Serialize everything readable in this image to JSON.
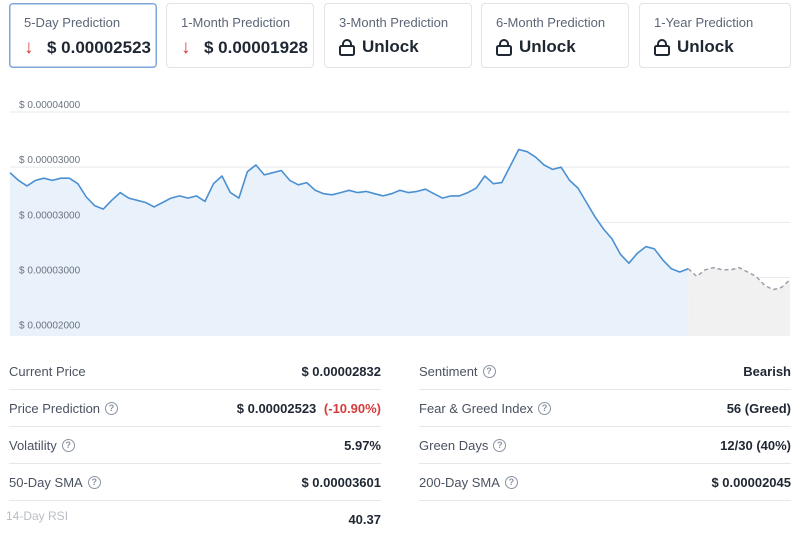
{
  "tabs": [
    {
      "label": "5-Day Prediction",
      "value": "$ 0.00002523",
      "type": "down",
      "active": true
    },
    {
      "label": "1-Month Prediction",
      "value": "$ 0.00001928",
      "type": "down",
      "active": false
    },
    {
      "label": "3-Month Prediction",
      "value": "Unlock",
      "type": "lock",
      "active": false
    },
    {
      "label": "6-Month Prediction",
      "value": "Unlock",
      "type": "lock",
      "active": false
    },
    {
      "label": "1-Year Prediction",
      "value": "Unlock",
      "type": "lock",
      "active": false
    }
  ],
  "chart_data": {
    "type": "area",
    "y_tick_labels": [
      "$ 0.00004000",
      "$ 0.00003000",
      "$ 0.00003000",
      "$ 0.00003000",
      "$ 0.00002000"
    ],
    "y_ticks": [
      4.0,
      3.5,
      3.0,
      2.5,
      2.0
    ],
    "ylim": [
      1.97,
      4.0
    ],
    "grid": true,
    "colors": {
      "history_line": "#4a90d2",
      "history_fill": "#e9f2fb",
      "prediction_line": "#9aa1ab",
      "prediction_fill": "#f1f1f1"
    },
    "series": [
      {
        "values": [
          3.45,
          3.38,
          3.33,
          3.38,
          3.4,
          3.38,
          3.4,
          3.4,
          3.35,
          3.23,
          3.15,
          3.12,
          3.2,
          3.27,
          3.22,
          3.2,
          3.18,
          3.14,
          3.18,
          3.22,
          3.24,
          3.22,
          3.24,
          3.19,
          3.35,
          3.42,
          3.27,
          3.22,
          3.46,
          3.52,
          3.43,
          3.45,
          3.47,
          3.38,
          3.34,
          3.36,
          3.29,
          3.26,
          3.25,
          3.27,
          3.29,
          3.27,
          3.28,
          3.26,
          3.24,
          3.26,
          3.29,
          3.27,
          3.28,
          3.3,
          3.26,
          3.22,
          3.24,
          3.24,
          3.27,
          3.31,
          3.42,
          3.35,
          3.36,
          3.51,
          3.66,
          3.64,
          3.59,
          3.52,
          3.48,
          3.5,
          3.38,
          3.31,
          3.18,
          3.05,
          2.94,
          2.85,
          2.71,
          2.63,
          2.72,
          2.78,
          2.76,
          2.66,
          2.58,
          2.55,
          2.58
        ]
      },
      {
        "values": [
          2.58,
          2.51,
          2.57,
          2.59,
          2.57,
          2.57,
          2.59,
          2.55,
          2.51,
          2.43,
          2.39,
          2.41,
          2.48
        ]
      }
    ]
  },
  "stats_left": [
    {
      "label": "Current Price",
      "help": false,
      "value": "$ 0.00002832",
      "extra": ""
    },
    {
      "label": "Price Prediction",
      "help": true,
      "value": "$ 0.00002523",
      "extra": "(-10.90%)"
    },
    {
      "label": "Volatility",
      "help": true,
      "value": "5.97%",
      "extra": ""
    },
    {
      "label": "50-Day SMA",
      "help": true,
      "value": "$ 0.00003601",
      "extra": ""
    },
    {
      "label": "",
      "help": false,
      "value": "40.37",
      "extra": ""
    }
  ],
  "stats_right": [
    {
      "label": "Sentiment",
      "help": true,
      "value": "Bearish",
      "color": "red"
    },
    {
      "label": "Fear & Greed Index",
      "help": true,
      "value": "56 (Greed)",
      "color": "green"
    },
    {
      "label": "Green Days",
      "help": true,
      "value": "12/30 (40%)",
      "color": "red"
    },
    {
      "label": "200-Day SMA",
      "help": true,
      "value": "$ 0.00002045",
      "color": ""
    }
  ],
  "watermark": "14-Day RSI"
}
